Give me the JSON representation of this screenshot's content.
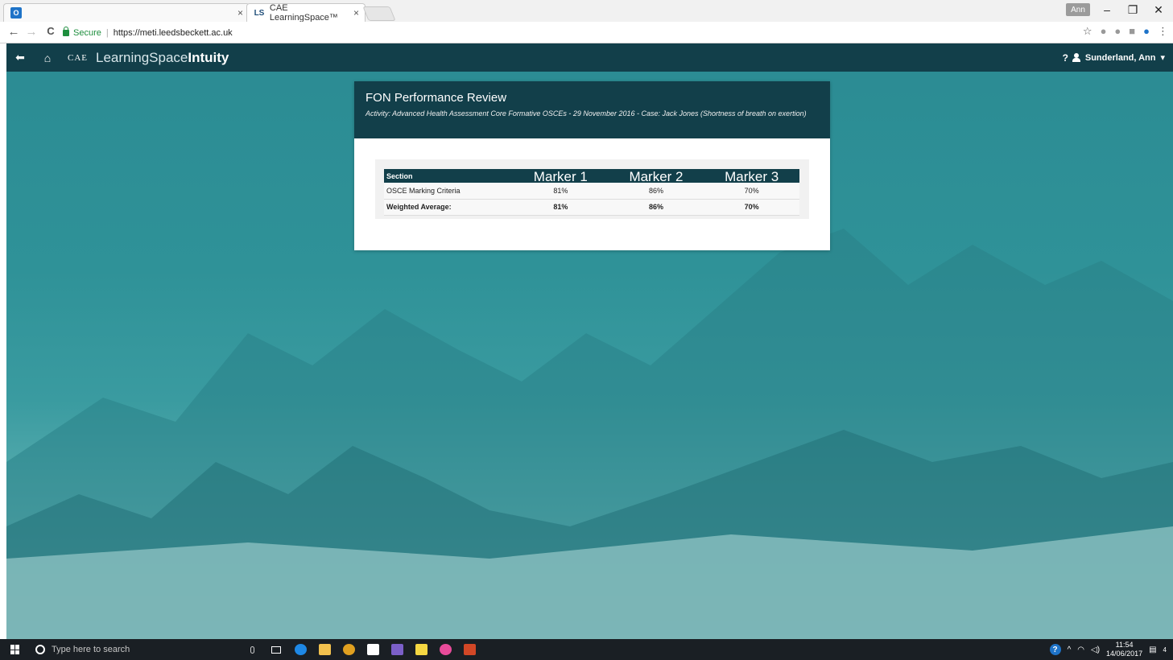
{
  "browser": {
    "tabs": [
      {
        "favicon": "O",
        "label": "",
        "close": "×"
      },
      {
        "favicon": "LS",
        "label": "CAE LearningSpace™",
        "close": "×"
      }
    ],
    "profile": "Ann",
    "window_controls": {
      "minimize": "–",
      "restore": "❐",
      "close": "✕"
    },
    "nav": {
      "back": "←",
      "forward": "→",
      "reload": "C"
    },
    "address": {
      "secure_label": "Secure",
      "url": "https://meti.leedsbeckett.ac.uk"
    },
    "star": "☆",
    "menu": "⋮"
  },
  "app": {
    "back_icon": "⬅",
    "home_icon": "⌂",
    "logo": {
      "cae": "CAE",
      "learningspace": "LearningSpace",
      "intuity": "Intuity"
    },
    "help": "?",
    "user": "Sunderland, Ann",
    "user_caret": "▾"
  },
  "review": {
    "title": "FON Performance Review",
    "subtitle": "Activity: Advanced Health Assessment Core Formative OSCEs - 29 November 2016 - Case: Jack Jones (Shortness of breath on exertion)",
    "table": {
      "headers": [
        "Section",
        "Marker 1",
        "Marker 2",
        "Marker 3"
      ],
      "rows": [
        [
          "OSCE Marking Criteria",
          "81%",
          "86%",
          "70%"
        ],
        [
          "Weighted Average:",
          "81%",
          "86%",
          "70%"
        ]
      ]
    }
  },
  "taskbar": {
    "search_placeholder": "Type here to search",
    "time": "11:54",
    "date": "14/06/2017",
    "notifications": "4"
  }
}
